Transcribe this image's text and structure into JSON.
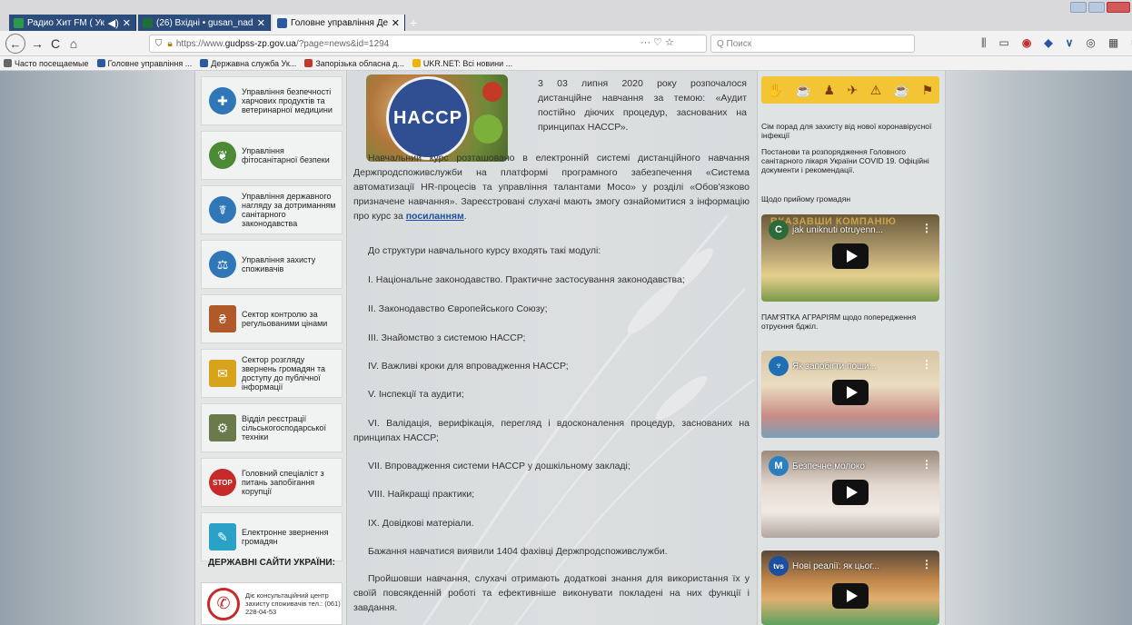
{
  "browser": {
    "tabs": [
      {
        "label": "Радио Хит FM ( Украина - ",
        "audio": "◀)",
        "color": "#2c9a4a"
      },
      {
        "label": "(26) Вхідні • gusan_nadzor@ul",
        "color": "#1d6e3a"
      },
      {
        "label": "Головне управління Держпро",
        "color": "#2c5aa0"
      }
    ],
    "new_tab": "+",
    "back": "←",
    "forward": "→",
    "reload": "C",
    "home": "⌂",
    "url_prefix": "https://www.",
    "url_domain": "gudpss-zp.gov.ua",
    "url_rest": "/?page=news&id=1294",
    "url_actions": "··· ♡ ☆",
    "search_placeholder": "Q Поиск",
    "bookmarks": [
      {
        "label": "Часто посещаемые",
        "color": "#666666"
      },
      {
        "label": "Головне управління ...",
        "color": "#2c5aa0"
      },
      {
        "label": "Державна служба Ук...",
        "color": "#2c5aa0"
      },
      {
        "label": "Запорізька обласна д...",
        "color": "#c0392b"
      },
      {
        "label": "UKR.NET: Всі новини ...",
        "color": "#f0b400"
      }
    ]
  },
  "left_sidebar": {
    "items": [
      {
        "label": "Управління безпечності харчових продуктів та ветеринарної медицини",
        "color": "#2f77b7",
        "glyph": "✚"
      },
      {
        "label": "Управління фітосанітарної безпеки",
        "color": "#4c8a35",
        "glyph": "❦"
      },
      {
        "label": "Управління державного нагляду за дотриманням санітарного законодавства",
        "color": "#2f77b7",
        "glyph": "☤"
      },
      {
        "label": "Управління захисту споживачів",
        "color": "#2f77b7",
        "glyph": "⚖"
      },
      {
        "label": "Сектор контролю за регульованими цінами",
        "color": "#b05a2a",
        "glyph": "₴"
      },
      {
        "label": "Сектор розгляду звернень громадян та доступу до публічної інформації",
        "color": "#d7a31c",
        "glyph": "✉"
      },
      {
        "label": "Відділ реєстрації сільськогосподарської техніки",
        "color": "#6a7a4a",
        "glyph": "⚙"
      },
      {
        "label": "Головний спеціаліст з питань запобігання корупції",
        "color": "#c52b2b",
        "glyph": "STOP"
      },
      {
        "label": "Електронне звернення громадян",
        "color": "#2aa2c8",
        "glyph": "✎"
      }
    ],
    "gov_sites_title": "ДЕРЖАВНІ САЙТИ УКРАЇНИ:",
    "hotline": "Діє консультаційний центр захисту споживачів тел.: (061) 228-04-53",
    "phone_glyph": "✆"
  },
  "article": {
    "hero_label": "HACCP",
    "intro": "3 03 липня 2020 року розпочалося дистанційне навчання за темою: «Аудит постійно діючих процедур, заснованих на принципах НАССР».",
    "p1": "Навчальний курс розташовано в електронній системі дистанційного навчання Держпродспоживслужби на платформі програмного забезпечення «Система автоматизації HR-процесів та управління талантами Мосо» у розділі «Обов'язково призначене навчання». Зареєстровані слухачі мають змогу ознайомитися з інформацію про курс за",
    "p1_link": "посиланням",
    "p1_end": ".",
    "modules_intro": "До структури навчального курсу входять такі модулі:",
    "modules": [
      "І. Національне законодавство. Практичне застосування законодавства;",
      "ІІ. Законодавство Європейського Союзу;",
      "ІІІ. Знайомство з системою НАССР;",
      "IV. Важливі кроки для впровадження НАССР;",
      "V. Інспекції та аудити;",
      "VІ. Валідація, верифікація, перегляд і вдосконалення процедур, заснованих на принципах НАССР;",
      "VІІ. Впровадження системи НАССР у дошкільному закладі;",
      "VІІІ. Найкращі практики;",
      "ІХ. Довідкові матеріали."
    ],
    "p_count": "Бажання навчатися виявили 1404 фахівці Держпродспоживслужби.",
    "p_final": "Пройшовши навчання, слухачі отримають додаткові знання для використання їх у своїй повсякденній роботі та ефективніше виконувати покладені на них функції і завдання."
  },
  "right_sidebar": {
    "icon_strip": [
      "✋",
      "☕",
      "♟",
      "✈",
      "⚠",
      "☕",
      "⚑"
    ],
    "link1": "Сім порад для захисту від нової коронавірусної інфекції",
    "link2": "Постанови та розпорядження Головного санітарного лікаря України COVID 19. Офіційні документи і рекомендації.",
    "link3": "Щодо прийому громадян",
    "videos": [
      {
        "title": "jak uniknuti otruyenn...",
        "chan": "C",
        "chan_color": "#2b6a3a",
        "overlay": "ВКАЗАВШИ КОМПАНІЮ"
      },
      {
        "title": "Як запобігти поши...",
        "chan": "♆",
        "chan_color": "#1f6fb5",
        "overlay": ""
      },
      {
        "title": "Безпечне молоко",
        "chan": "M",
        "chan_color": "#2a7fc0",
        "overlay": ""
      },
      {
        "title": "Нові реалії: як цьог...",
        "chan": "tvs",
        "chan_color": "#1b4fa0",
        "overlay": ""
      }
    ],
    "pam_label": "ПАМ'ЯТКА АГРАРІЯМ щодо попередження отруєння бджіл.",
    "more_glyph": "⋮"
  }
}
